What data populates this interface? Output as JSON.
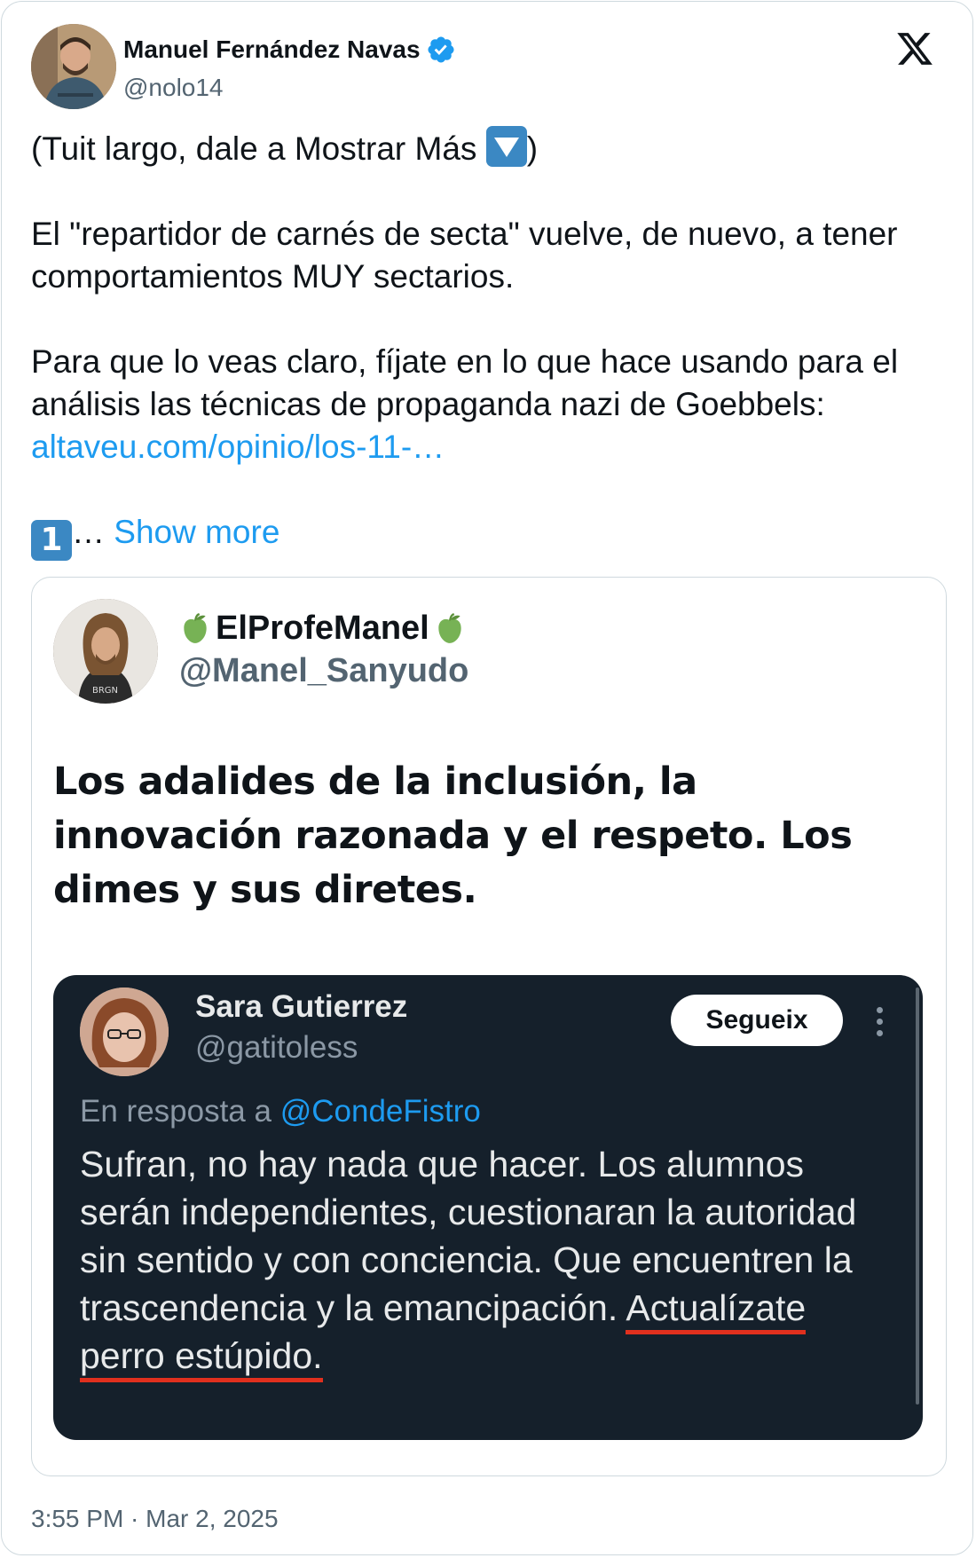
{
  "tweet": {
    "author_name": "Manuel Fernández Navas",
    "author_handle": "@nolo14",
    "para1_before": "(Tuit largo, dale a Mostrar Más ",
    "para1_after": ")",
    "para2": "El \"repartidor de carnés de secta\" vuelve, de nuevo, a tener comportamientos MUY sectarios.",
    "para3": "Para que lo veas claro, fíjate en lo que hace usando para el análisis las técnicas de propaganda nazi de Goebbels:",
    "link": "altaveu.com/opinio/los-11-…",
    "numbered_emoji": "1",
    "ellipsis": "…",
    "show_more": "Show more",
    "timestamp": "3:55 PM · Mar 2, 2025"
  },
  "quote": {
    "name": "ElProfeManel",
    "handle": "@Manel_Sanyudo",
    "text": "Los adalides de la inclusión, la innovación razonada y el respeto. Los dimes y sus diretes."
  },
  "screenshot": {
    "name": "Sara Gutierrez",
    "handle": "@gatitoless",
    "follow_label": "Segueix",
    "reply_prefix": "En resposta a ",
    "reply_handle": "@CondeFistro",
    "text_main": "Sufran, no hay nada que hacer. Los alumnos serán independientes, cuestionaran la autoridad sin sentido y con conciencia. Que encuentren la trascendencia y la emancipación. ",
    "text_underlined": "Actualízate perro estúpido."
  },
  "colors": {
    "link": "#1d9bf0",
    "dark_bg": "#15202b",
    "underline": "#e0301e"
  },
  "icons": [
    "verified-badge-icon",
    "x-logo-icon",
    "down-arrow-emoji-icon",
    "keycap-one-emoji-icon",
    "green-apple-emoji-icon",
    "more-options-icon"
  ]
}
